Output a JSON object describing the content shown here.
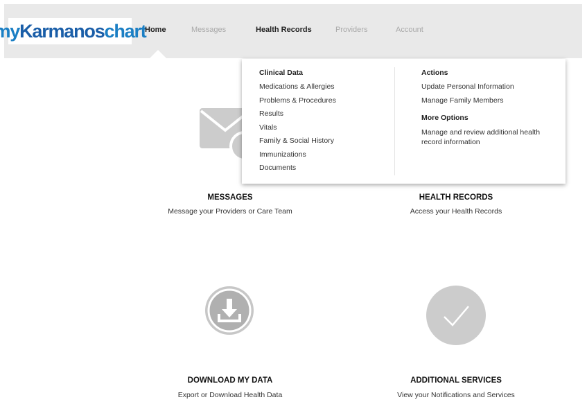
{
  "brand": {
    "logo_part1": "my",
    "logo_part2": "Karmanos",
    "logo_part3": "chart"
  },
  "nav": {
    "items": [
      {
        "label": "Home"
      },
      {
        "label": "Messages"
      },
      {
        "label": "Health Records"
      },
      {
        "label": "Providers"
      },
      {
        "label": "Account"
      }
    ]
  },
  "dropdown": {
    "clinical": {
      "heading": "Clinical Data",
      "links": [
        "Medications & Allergies",
        "Problems & Procedures",
        "Results",
        "Vitals",
        "Family & Social History",
        "Immunizations",
        "Documents"
      ]
    },
    "actions": {
      "heading": "Actions",
      "links": [
        "Update Personal Information",
        "Manage Family Members"
      ]
    },
    "more": {
      "heading": "More Options",
      "link": "Manage and review additional health record information"
    }
  },
  "tiles": [
    {
      "title": "MESSAGES",
      "desc": "Message your Providers or Care Team",
      "icon": "envelope-icon"
    },
    {
      "title": "HEALTH RECORDS",
      "desc": "Access your Health Records",
      "icon": "health-record-icon"
    },
    {
      "title": "DOWNLOAD MY DATA",
      "desc": "Export or Download Health Data",
      "icon": "download-icon"
    },
    {
      "title": "ADDITIONAL SERVICES",
      "desc": "View your Notifications and Services",
      "icon": "checkmark-icon"
    }
  ],
  "colors": {
    "brand_blue": "#1b7fc4",
    "nav_bg": "#e9e9e9",
    "icon_gray": "#cccccc"
  }
}
